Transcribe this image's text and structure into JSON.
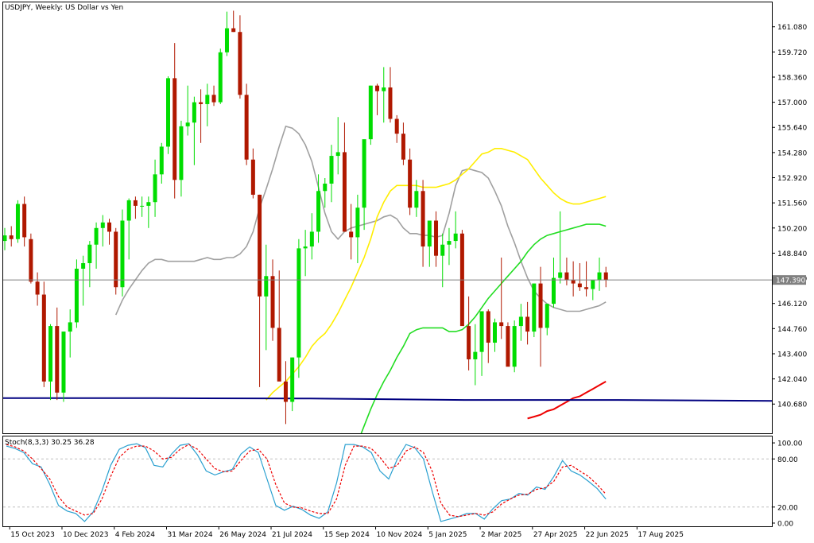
{
  "window": {
    "title": "USDJPY, Weekly:  US Dollar vs Yen",
    "stoch_title": "Stoch(8,3,3) 30.25 36.28"
  },
  "colors": {
    "bull": "#00dd00",
    "bear": "#b01800",
    "wick_bull": "#00dd00",
    "wick_bear": "#b01800",
    "ma_gray": "#a0a0a0",
    "ma_yellow": "#ffee00",
    "ma_green": "#22dd22",
    "ma_red": "#ee0000",
    "ma_navy": "#000080",
    "stoch_main": "#2aa0d0",
    "stoch_signal": "#ee0000",
    "price_line": "#808080",
    "grid_dash": "#c0c0c0"
  },
  "chart_data": [
    {
      "type": "candlestick",
      "title": "USDJPY, Weekly:  US Dollar vs Yen",
      "ylim": [
        139.1,
        162.4
      ],
      "y_ticks": [
        "161.080",
        "159.720",
        "158.360",
        "157.000",
        "155.640",
        "154.280",
        "152.920",
        "151.560",
        "150.200",
        "148.840",
        "147.480",
        "146.120",
        "144.760",
        "143.400",
        "142.040",
        "140.680"
      ],
      "current_price": "147.390",
      "x_ticks": [
        "15 Oct 2023",
        "10 Dec 2023",
        "4 Feb 2024",
        "31 Mar 2024",
        "26 May 2024",
        "21 Jul 2024",
        "15 Sep 2024",
        "10 Nov 2024",
        "5 Jan 2025",
        "2 Mar 2025",
        "27 Apr 2025",
        "22 Jun 2025",
        "17 Aug 2025"
      ],
      "x_tick_index": [
        1,
        9,
        17,
        25,
        33,
        41,
        49,
        57,
        65,
        73,
        81,
        89,
        97
      ],
      "ohlc": [
        [
          149.5,
          150.2,
          149.0,
          149.8
        ],
        [
          149.8,
          150.3,
          149.2,
          149.6
        ],
        [
          149.6,
          151.7,
          149.4,
          151.5
        ],
        [
          151.5,
          151.9,
          149.2,
          149.7
        ],
        [
          149.6,
          149.9,
          147.2,
          147.3
        ],
        [
          147.3,
          147.8,
          146.0,
          146.6
        ],
        [
          146.6,
          147.3,
          141.6,
          141.9
        ],
        [
          141.9,
          145.0,
          140.9,
          144.9
        ],
        [
          144.9,
          145.9,
          140.9,
          141.3
        ],
        [
          141.3,
          144.6,
          140.8,
          144.6
        ],
        [
          144.6,
          145.8,
          143.2,
          145.1
        ],
        [
          145.1,
          148.5,
          144.8,
          148.0
        ],
        [
          148.0,
          148.7,
          146.0,
          148.3
        ],
        [
          148.3,
          149.5,
          147.0,
          149.3
        ],
        [
          149.3,
          150.5,
          148.0,
          150.2
        ],
        [
          150.2,
          150.9,
          149.2,
          150.5
        ],
        [
          150.5,
          150.7,
          149.3,
          150.0
        ],
        [
          150.0,
          150.2,
          146.6,
          147.0
        ],
        [
          147.0,
          151.2,
          146.5,
          150.6
        ],
        [
          150.6,
          151.8,
          148.5,
          151.7
        ],
        [
          151.7,
          151.9,
          150.7,
          151.4
        ],
        [
          151.4,
          151.9,
          150.8,
          151.4
        ],
        [
          151.4,
          151.9,
          150.2,
          151.6
        ],
        [
          151.6,
          153.9,
          150.8,
          153.1
        ],
        [
          153.1,
          154.8,
          152.6,
          154.6
        ],
        [
          154.6,
          158.4,
          154.2,
          158.3
        ],
        [
          158.3,
          160.2,
          151.8,
          152.8
        ],
        [
          152.8,
          156.0,
          151.9,
          155.7
        ],
        [
          155.7,
          157.9,
          155.2,
          155.9
        ],
        [
          155.9,
          157.3,
          153.6,
          157.0
        ],
        [
          157.0,
          157.7,
          154.8,
          156.9
        ],
        [
          156.9,
          158.0,
          155.7,
          157.4
        ],
        [
          157.4,
          157.9,
          156.8,
          157.0
        ],
        [
          157.0,
          159.9,
          156.9,
          159.7
        ],
        [
          159.7,
          161.9,
          159.5,
          161.0
        ],
        [
          161.0,
          161.95,
          160.8,
          160.8
        ],
        [
          160.8,
          161.7,
          157.2,
          157.4
        ],
        [
          157.4,
          158.0,
          153.6,
          153.9
        ],
        [
          153.9,
          154.5,
          151.8,
          152.0
        ],
        [
          152.0,
          152.0,
          141.6,
          146.5
        ],
        [
          146.5,
          149.3,
          143.6,
          147.6
        ],
        [
          147.6,
          148.5,
          144.1,
          144.8
        ],
        [
          144.8,
          147.9,
          142.0,
          141.9
        ],
        [
          141.9,
          143.0,
          139.6,
          140.8
        ],
        [
          140.8,
          143.2,
          140.3,
          143.2
        ],
        [
          143.2,
          149.6,
          142.1,
          149.1
        ],
        [
          149.1,
          150.1,
          147.6,
          149.2
        ],
        [
          149.2,
          151.0,
          148.5,
          150.0
        ],
        [
          150.0,
          153.1,
          149.4,
          152.2
        ],
        [
          152.2,
          152.9,
          151.3,
          152.6
        ],
        [
          152.6,
          154.7,
          151.6,
          154.1
        ],
        [
          154.1,
          156.2,
          153.1,
          154.3
        ],
        [
          154.3,
          155.9,
          153.3,
          150.0
        ],
        [
          150.0,
          151.5,
          148.5,
          149.7
        ],
        [
          149.7,
          152.0,
          148.3,
          151.3
        ],
        [
          151.3,
          154.8,
          150.1,
          155.0
        ],
        [
          155.0,
          157.9,
          154.7,
          157.9
        ],
        [
          157.9,
          158.0,
          156.3,
          157.6
        ],
        [
          157.6,
          158.9,
          155.9,
          157.8
        ],
        [
          157.8,
          158.9,
          155.9,
          156.1
        ],
        [
          156.1,
          156.3,
          154.8,
          155.3
        ],
        [
          155.3,
          155.9,
          153.6,
          153.9
        ],
        [
          153.9,
          154.5,
          150.9,
          151.3
        ],
        [
          151.3,
          152.8,
          150.8,
          152.2
        ],
        [
          152.2,
          152.8,
          148.1,
          149.2
        ],
        [
          149.2,
          150.5,
          148.1,
          150.6
        ],
        [
          150.6,
          151.1,
          148.1,
          148.7
        ],
        [
          148.7,
          149.9,
          147.0,
          149.3
        ],
        [
          149.3,
          150.2,
          148.2,
          149.5
        ],
        [
          149.5,
          151.1,
          149.1,
          149.9
        ],
        [
          149.9,
          150.1,
          145.0,
          144.9
        ],
        [
          144.9,
          146.5,
          142.5,
          143.1
        ],
        [
          143.1,
          145.0,
          141.7,
          143.5
        ],
        [
          143.5,
          145.6,
          142.2,
          145.7
        ],
        [
          145.7,
          145.8,
          142.9,
          144.0
        ],
        [
          144.0,
          145.3,
          143.5,
          145.1
        ],
        [
          145.1,
          148.6,
          144.2,
          144.9
        ],
        [
          144.9,
          145.1,
          142.8,
          142.7
        ],
        [
          142.7,
          145.2,
          142.4,
          144.9
        ],
        [
          144.9,
          146.1,
          144.1,
          145.4
        ],
        [
          145.4,
          146.2,
          143.9,
          144.6
        ],
        [
          144.6,
          147.2,
          144.3,
          147.2
        ],
        [
          147.2,
          148.1,
          142.7,
          144.8
        ],
        [
          144.8,
          146.1,
          144.4,
          146.1
        ],
        [
          146.1,
          148.6,
          145.9,
          147.5
        ],
        [
          147.5,
          151.1,
          147.2,
          147.8
        ],
        [
          147.8,
          148.6,
          147.1,
          147.4
        ],
        [
          147.4,
          148.4,
          146.5,
          147.2
        ],
        [
          147.2,
          148.3,
          146.8,
          147.0
        ],
        [
          147.0,
          148.4,
          146.5,
          146.9
        ],
        [
          146.9,
          147.3,
          146.3,
          147.4
        ],
        [
          147.4,
          148.6,
          146.8,
          147.8
        ],
        [
          147.8,
          148.1,
          147.0,
          147.4
        ]
      ],
      "series": [
        {
          "name": "",
          "color": "#a0a0a0",
          "values": [
            145.5,
            146.3,
            146.9,
            147.4,
            147.9,
            148.3,
            148.5,
            148.5,
            148.4,
            148.4,
            148.4,
            148.4,
            148.4,
            148.5,
            148.6,
            148.5,
            148.5,
            148.6,
            148.6,
            148.8,
            149.2,
            150.0,
            151.3,
            152.3,
            153.4,
            154.6,
            155.7,
            155.6,
            155.3,
            154.7,
            153.8,
            152.4,
            151.0,
            150.0,
            149.6,
            150.0,
            150.2,
            150.3,
            150.4,
            150.5,
            150.6,
            150.8,
            150.9,
            150.7,
            150.2,
            149.9,
            149.9,
            149.8,
            149.8,
            149.7,
            149.8,
            151.0,
            152.5,
            153.3,
            153.4,
            153.3,
            153.2,
            152.9,
            152.2,
            151.4,
            150.3,
            149.4,
            148.4,
            147.5,
            146.8,
            146.4,
            146.1,
            145.9,
            145.8,
            145.7,
            145.7,
            145.7,
            145.8,
            145.9,
            146.0,
            146.2
          ]
        },
        {
          "name": "",
          "color": "#ffee00",
          "values": [
            140.9,
            141.3,
            141.6,
            141.9,
            142.3,
            142.7,
            143.2,
            143.8,
            144.2,
            144.5,
            145.0,
            145.6,
            146.3,
            147.0,
            147.8,
            148.6,
            149.6,
            150.8,
            151.6,
            152.2,
            152.5,
            152.5,
            152.5,
            152.5,
            152.4,
            152.4,
            152.4,
            152.5,
            152.6,
            152.8,
            153.1,
            153.4,
            153.8,
            154.2,
            154.3,
            154.5,
            154.5,
            154.4,
            154.3,
            154.1,
            153.9,
            153.4,
            152.9,
            152.5,
            152.1,
            151.8,
            151.6,
            151.5,
            151.5,
            151.6,
            151.7,
            151.8,
            151.9
          ]
        },
        {
          "name": "",
          "color": "#22dd22",
          "values": [
            138.6,
            139.5,
            140.4,
            141.2,
            141.9,
            142.5,
            143.2,
            143.8,
            144.5,
            144.7,
            144.8,
            144.8,
            144.8,
            144.8,
            144.6,
            144.6,
            144.7,
            145.0,
            145.4,
            145.9,
            146.4,
            146.8,
            147.2,
            147.6,
            148.0,
            148.4,
            148.9,
            149.3,
            149.6,
            149.8,
            149.9,
            150.0,
            150.1,
            150.2,
            150.3,
            150.4,
            150.4,
            150.4,
            150.3
          ]
        },
        {
          "name": "",
          "color": "#ee0000",
          "values": [
            139.9,
            140.0,
            140.1,
            140.3,
            140.4,
            140.6,
            140.8,
            141.0,
            141.1,
            141.3,
            141.5,
            141.7,
            141.9
          ]
        },
        {
          "name": "",
          "color": "#000080",
          "values": [
            141.0,
            141.0,
            140.98,
            140.9,
            140.9,
            140.85
          ]
        }
      ]
    },
    {
      "type": "line",
      "title": "Stoch(8,3,3) 30.25 36.28",
      "ylim": [
        -4,
        108
      ],
      "y_ticks": [
        "100.00",
        "80.00",
        "20.00",
        "0.00"
      ],
      "levels": [
        80,
        20
      ],
      "series": [
        {
          "name": "",
          "color": "#2aa0d0",
          "values": [
            96,
            93,
            88,
            74,
            70,
            48,
            22,
            15,
            12,
            2,
            14,
            40,
            72,
            92,
            97,
            99,
            94,
            72,
            70,
            86,
            97,
            99,
            85,
            65,
            60,
            64,
            67,
            86,
            95,
            88,
            55,
            22,
            16,
            21,
            17,
            10,
            6,
            14,
            50,
            98,
            98,
            95,
            88,
            65,
            55,
            80,
            98,
            94,
            80,
            40,
            2,
            5,
            8,
            12,
            12,
            5,
            18,
            28,
            30,
            37,
            35,
            45,
            42,
            58,
            78,
            65,
            60,
            52,
            43,
            30
          ]
        },
        {
          "name": "",
          "color": "#ee0000",
          "values": [
            98,
            95,
            90,
            80,
            68,
            55,
            33,
            20,
            15,
            10,
            12,
            30,
            58,
            82,
            92,
            96,
            96,
            90,
            80,
            82,
            92,
            98,
            92,
            80,
            68,
            64,
            65,
            78,
            90,
            92,
            80,
            48,
            25,
            20,
            19,
            15,
            12,
            12,
            30,
            72,
            96,
            96,
            93,
            82,
            68,
            72,
            90,
            95,
            88,
            65,
            25,
            10,
            8,
            10,
            12,
            10,
            14,
            24,
            30,
            35,
            36,
            42,
            44,
            52,
            70,
            72,
            65,
            58,
            48,
            36
          ]
        }
      ]
    }
  ]
}
